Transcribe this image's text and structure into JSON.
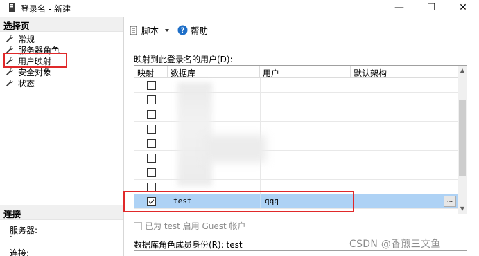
{
  "window": {
    "title": "登录名 - 新建",
    "min_glyph": "—",
    "max_glyph": "☐",
    "close_glyph": "✕"
  },
  "left": {
    "select_page_header": "选择页",
    "nav": [
      {
        "label": "常规",
        "icon": "wrench-icon"
      },
      {
        "label": "服务器角色",
        "icon": "wrench-icon"
      },
      {
        "label": "用户映射",
        "icon": "wrench-icon"
      },
      {
        "label": "安全对象",
        "icon": "wrench-icon"
      },
      {
        "label": "状态",
        "icon": "wrench-icon"
      }
    ],
    "connection_header": "连接",
    "server_label": "服务器:",
    "server_value": "·",
    "connection_label": "连接:"
  },
  "toolbar": {
    "script_label": "脚本",
    "help_label": "帮助"
  },
  "mapping": {
    "label": "映射到此登录名的用户(D):",
    "columns": [
      "映射",
      "数据库",
      "用户",
      "默认架构"
    ],
    "rows": [
      {
        "checked": false,
        "database": "",
        "user": "",
        "schema": ""
      },
      {
        "checked": false,
        "database": "",
        "user": "",
        "schema": ""
      },
      {
        "checked": false,
        "database": "",
        "user": "",
        "schema": ""
      },
      {
        "checked": false,
        "database": "",
        "user": "",
        "schema": ""
      },
      {
        "checked": false,
        "database": "",
        "user": "",
        "schema": ""
      },
      {
        "checked": false,
        "database": "",
        "user": "",
        "schema": ""
      },
      {
        "checked": false,
        "database": "",
        "user": "",
        "schema": ""
      },
      {
        "checked": false,
        "database": "",
        "user": "",
        "schema": ""
      },
      {
        "checked": true,
        "database": "test",
        "user": "qqq",
        "schema": ""
      }
    ],
    "ellipsis": "..."
  },
  "guest": {
    "label": "已为 test 启用 Guest 帐户"
  },
  "roles": {
    "label": "数据库角色成员身份(R): test"
  },
  "watermark": "CSDN @香煎三文鱼",
  "colors": {
    "highlight_red": "#e0292a",
    "selected_row": "#aed2f5",
    "help_blue": "#1e6fc8"
  }
}
